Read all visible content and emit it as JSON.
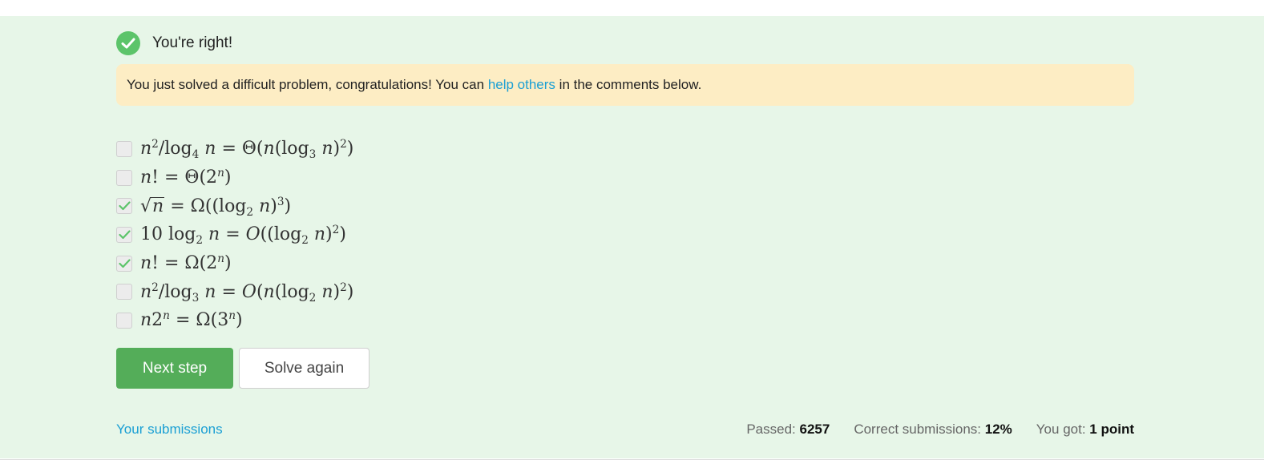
{
  "status": {
    "icon": "check-circle-icon",
    "text": "You're right!",
    "color": "#5cc46a"
  },
  "notice": {
    "text_before": "You just solved a difficult problem, congratulations! You can ",
    "link_text": "help others",
    "text_after": " in the comments below."
  },
  "options": [
    {
      "formula": "n²/log₄ n = Θ(n(log₃ n)²)",
      "checked": false
    },
    {
      "formula": "n! = Θ(2ⁿ)",
      "checked": false
    },
    {
      "formula": "√n = Ω((log₂ n)³)",
      "checked": true
    },
    {
      "formula": "10 log₂ n = O((log₂ n)²)",
      "checked": true
    },
    {
      "formula": "n! = Ω(2ⁿ)",
      "checked": true
    },
    {
      "formula": "n²/log₃ n = O(n(log₂ n)²)",
      "checked": false
    },
    {
      "formula": "n2ⁿ = Ω(3ⁿ)",
      "checked": false
    }
  ],
  "buttons": {
    "next_step": "Next step",
    "solve_again": "Solve again"
  },
  "footer": {
    "submissions_link": "Your submissions",
    "passed_label": "Passed: ",
    "passed_value": "6257",
    "correct_label": "Correct submissions: ",
    "correct_value": "12%",
    "got_label": "You got: ",
    "got_value": "1 point"
  },
  "colors": {
    "panel_bg": "#e7f6e8",
    "notice_bg": "#fdedc4",
    "primary_button": "#54ad59",
    "link": "#1a9fd4",
    "check": "#5cc46a"
  }
}
